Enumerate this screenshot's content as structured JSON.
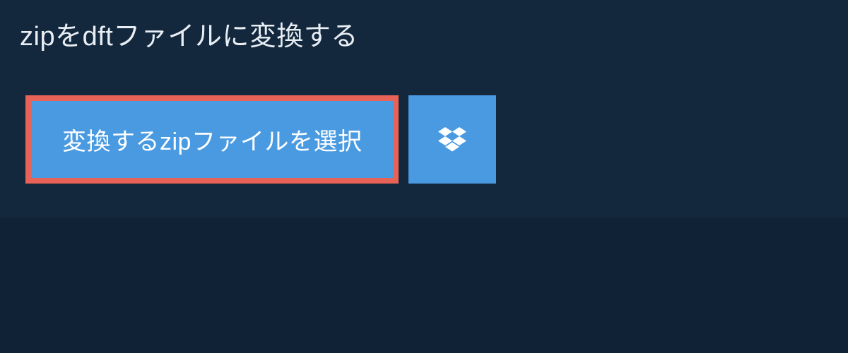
{
  "heading": "zipをdftファイルに変換する",
  "select_button_label": "変換するzipファイルを選択",
  "colors": {
    "page_bg": "#0f2236",
    "panel_bg": "#14283d",
    "button_bg": "#4a9ae1",
    "button_border": "#e76257",
    "text_light": "#e8eef4",
    "text_white": "#ffffff"
  }
}
